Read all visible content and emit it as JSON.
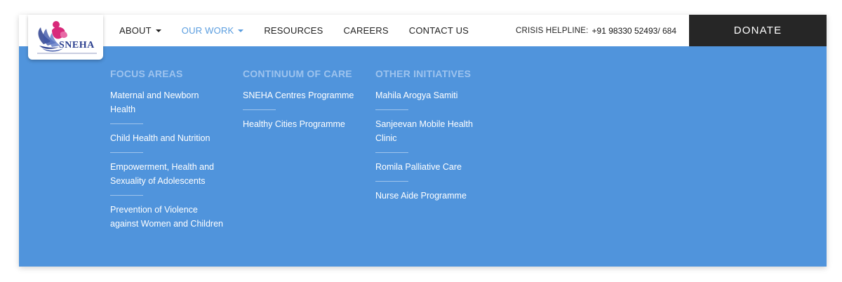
{
  "logo": {
    "text": "SNEHA",
    "icon": "sneha-lotus-logo"
  },
  "nav": {
    "items": [
      {
        "label": "ABOUT",
        "has_dropdown": true,
        "active": false
      },
      {
        "label": "OUR WORK",
        "has_dropdown": true,
        "active": true
      },
      {
        "label": "RESOURCES",
        "has_dropdown": false,
        "active": false
      },
      {
        "label": "CAREERS",
        "has_dropdown": false,
        "active": false
      },
      {
        "label": "CONTACT US",
        "has_dropdown": false,
        "active": false
      }
    ]
  },
  "helpline": {
    "label": "CRISIS HELPLINE:",
    "number": "+91 98330 52493",
    "extension": " / 684"
  },
  "donate": {
    "label": "DONATE"
  },
  "menu": {
    "columns": [
      {
        "heading": "FOCUS AREAS",
        "links": [
          "Maternal and Newborn Health",
          "Child Health and Nutrition",
          "Empowerment, Health and Sexuality of Adolescents",
          "Prevention of Violence against Women and Children"
        ]
      },
      {
        "heading": "CONTINUUM OF CARE",
        "links": [
          "SNEHA Centres Programme",
          "Healthy Cities Programme"
        ]
      },
      {
        "heading": "OTHER INITIATIVES",
        "links": [
          "Mahila Arogya Samiti",
          "Sanjeevan Mobile Health Clinic",
          "Romila Palliative Care",
          "Nurse Aide Programme"
        ]
      }
    ]
  },
  "colors": {
    "menu_background": "#5094dc",
    "heading": "#9dc3ee",
    "active_nav": "#5a9ddf",
    "donate_background": "#262626",
    "logo_pink": "#d8297a",
    "logo_blue": "#2b3f8f"
  }
}
